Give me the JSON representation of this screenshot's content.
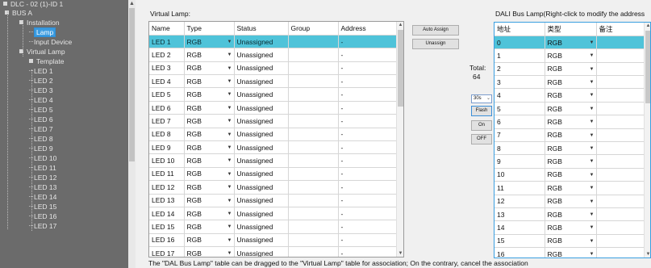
{
  "sidebar": {
    "root": "DLC - 02 (1)-ID 1",
    "items": [
      {
        "label": "BUS A",
        "level": 1,
        "icon": "node"
      },
      {
        "label": "Installation",
        "level": 2,
        "icon": "node"
      },
      {
        "label": "Lamp",
        "level": 3,
        "icon": "none",
        "selected": true
      },
      {
        "label": "Input Device",
        "level": 3,
        "icon": "none"
      },
      {
        "label": "Virtual Lamp",
        "level": 2,
        "icon": "node"
      },
      {
        "label": "Template",
        "level": 3,
        "icon": "node"
      },
      {
        "label": "LED 1",
        "level": 4,
        "icon": "none"
      },
      {
        "label": "LED 2",
        "level": 4,
        "icon": "none"
      },
      {
        "label": "LED 3",
        "level": 4,
        "icon": "none"
      },
      {
        "label": "LED 4",
        "level": 4,
        "icon": "none"
      },
      {
        "label": "LED 5",
        "level": 4,
        "icon": "none"
      },
      {
        "label": "LED 6",
        "level": 4,
        "icon": "none"
      },
      {
        "label": "LED 7",
        "level": 4,
        "icon": "none"
      },
      {
        "label": "LED 8",
        "level": 4,
        "icon": "none"
      },
      {
        "label": "LED 9",
        "level": 4,
        "icon": "none"
      },
      {
        "label": "LED 10",
        "level": 4,
        "icon": "none"
      },
      {
        "label": "LED 11",
        "level": 4,
        "icon": "none"
      },
      {
        "label": "LED 12",
        "level": 4,
        "icon": "none"
      },
      {
        "label": "LED 13",
        "level": 4,
        "icon": "none"
      },
      {
        "label": "LED 14",
        "level": 4,
        "icon": "none"
      },
      {
        "label": "LED 15",
        "level": 4,
        "icon": "none"
      },
      {
        "label": "LED 16",
        "level": 4,
        "icon": "none"
      },
      {
        "label": "LED 17",
        "level": 4,
        "icon": "none"
      }
    ]
  },
  "virtual_lamp": {
    "caption": "Virtual Lamp:",
    "columns": [
      "Name",
      "Type",
      "Status",
      "Group",
      "Address"
    ],
    "rows": [
      {
        "name": "LED 1",
        "type": "RGB",
        "status": "Unassigned",
        "group": "",
        "address": "-",
        "selected": true
      },
      {
        "name": "LED 2",
        "type": "RGB",
        "status": "Unassigned",
        "group": "",
        "address": "-"
      },
      {
        "name": "LED 3",
        "type": "RGB",
        "status": "Unassigned",
        "group": "",
        "address": "-"
      },
      {
        "name": "LED 4",
        "type": "RGB",
        "status": "Unassigned",
        "group": "",
        "address": "-"
      },
      {
        "name": "LED 5",
        "type": "RGB",
        "status": "Unassigned",
        "group": "",
        "address": "-"
      },
      {
        "name": "LED 6",
        "type": "RGB",
        "status": "Unassigned",
        "group": "",
        "address": "-"
      },
      {
        "name": "LED 7",
        "type": "RGB",
        "status": "Unassigned",
        "group": "",
        "address": "-"
      },
      {
        "name": "LED 8",
        "type": "RGB",
        "status": "Unassigned",
        "group": "",
        "address": "-"
      },
      {
        "name": "LED 9",
        "type": "RGB",
        "status": "Unassigned",
        "group": "",
        "address": "-"
      },
      {
        "name": "LED 10",
        "type": "RGB",
        "status": "Unassigned",
        "group": "",
        "address": "-"
      },
      {
        "name": "LED 11",
        "type": "RGB",
        "status": "Unassigned",
        "group": "",
        "address": "-"
      },
      {
        "name": "LED 12",
        "type": "RGB",
        "status": "Unassigned",
        "group": "",
        "address": "-"
      },
      {
        "name": "LED 13",
        "type": "RGB",
        "status": "Unassigned",
        "group": "",
        "address": "-"
      },
      {
        "name": "LED 14",
        "type": "RGB",
        "status": "Unassigned",
        "group": "",
        "address": "-"
      },
      {
        "name": "LED 15",
        "type": "RGB",
        "status": "Unassigned",
        "group": "",
        "address": "-"
      },
      {
        "name": "LED 16",
        "type": "RGB",
        "status": "Unassigned",
        "group": "",
        "address": "-"
      },
      {
        "name": "LED 17",
        "type": "RGB",
        "status": "Unassigned",
        "group": "",
        "address": "-"
      }
    ]
  },
  "controls": {
    "auto_assign": "Auto Assign",
    "unassign": "Unassign",
    "total_label": "Total:",
    "total_value": "64",
    "interval_select": "30s",
    "flash": "Flash",
    "on": "On",
    "off": "OFF"
  },
  "dali_lamp": {
    "caption": "DALI Bus Lamp(Right-click to modify the address",
    "columns": [
      "地址",
      "类型",
      "备注"
    ],
    "rows": [
      {
        "address": "0",
        "type": "RGB",
        "note": "",
        "selected": true
      },
      {
        "address": "1",
        "type": "RGB",
        "note": ""
      },
      {
        "address": "2",
        "type": "RGB",
        "note": ""
      },
      {
        "address": "3",
        "type": "RGB",
        "note": ""
      },
      {
        "address": "4",
        "type": "RGB",
        "note": ""
      },
      {
        "address": "5",
        "type": "RGB",
        "note": ""
      },
      {
        "address": "6",
        "type": "RGB",
        "note": ""
      },
      {
        "address": "7",
        "type": "RGB",
        "note": ""
      },
      {
        "address": "8",
        "type": "RGB",
        "note": ""
      },
      {
        "address": "9",
        "type": "RGB",
        "note": ""
      },
      {
        "address": "10",
        "type": "RGB",
        "note": ""
      },
      {
        "address": "11",
        "type": "RGB",
        "note": ""
      },
      {
        "address": "12",
        "type": "RGB",
        "note": ""
      },
      {
        "address": "13",
        "type": "RGB",
        "note": ""
      },
      {
        "address": "14",
        "type": "RGB",
        "note": ""
      },
      {
        "address": "15",
        "type": "RGB",
        "note": ""
      },
      {
        "address": "16",
        "type": "RGB",
        "note": ""
      }
    ]
  },
  "footer_note": "The \"DAL Bus Lamp\" table can be dragged to the \"Virtual Lamp\" table for association; On the contrary, cancel the association",
  "colors": {
    "sidebar_bg": "#6b6b6b",
    "selection": "#4fc3d9",
    "accent_border": "#3a9fe0"
  }
}
